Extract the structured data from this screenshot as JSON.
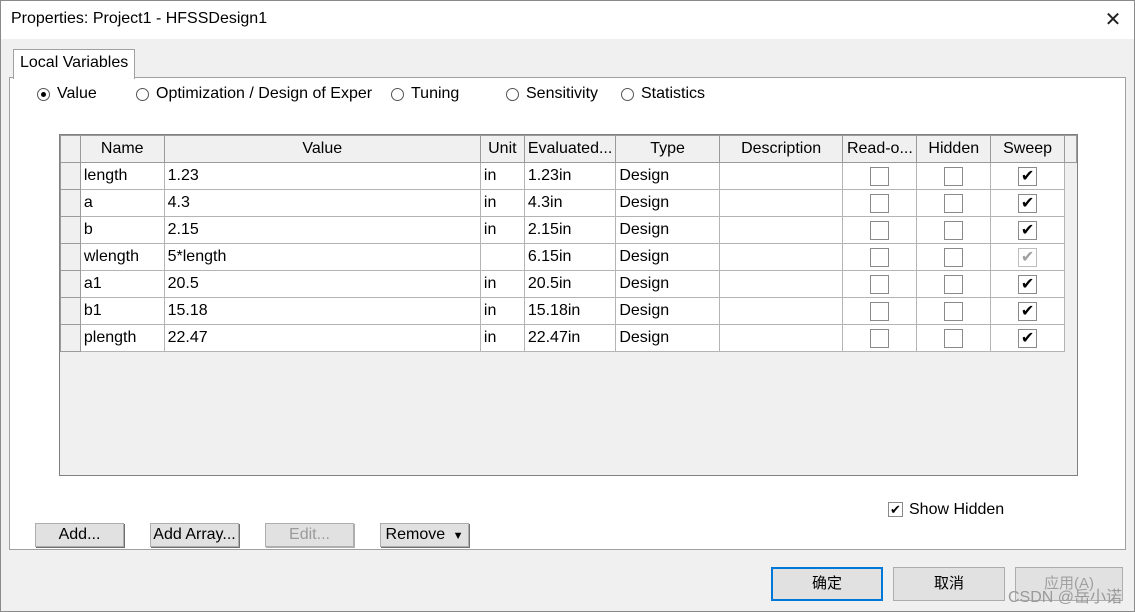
{
  "window": {
    "title": "Properties: Project1 - HFSSDesign1",
    "close_glyph": "✕"
  },
  "tab": {
    "label": "Local Variables"
  },
  "modes": [
    {
      "label": "Value",
      "checked": true
    },
    {
      "label": "Optimization / Design of Exper",
      "checked": false
    },
    {
      "label": "Tuning",
      "checked": false
    },
    {
      "label": "Sensitivity",
      "checked": false
    },
    {
      "label": "Statistics",
      "checked": false
    }
  ],
  "table": {
    "columns": [
      "Name",
      "Value",
      "Unit",
      "Evaluated...",
      "Type",
      "Description",
      "Read-o...",
      "Hidden",
      "Sweep"
    ],
    "rows": [
      {
        "name": "length",
        "value": "1.23",
        "unit": "in",
        "evaluated": "1.23in",
        "type": "Design",
        "description": "",
        "readonly": false,
        "hidden": false,
        "sweep": true,
        "sweep_disabled": false
      },
      {
        "name": "a",
        "value": "4.3",
        "unit": "in",
        "evaluated": "4.3in",
        "type": "Design",
        "description": "",
        "readonly": false,
        "hidden": false,
        "sweep": true,
        "sweep_disabled": false
      },
      {
        "name": "b",
        "value": "2.15",
        "unit": "in",
        "evaluated": "2.15in",
        "type": "Design",
        "description": "",
        "readonly": false,
        "hidden": false,
        "sweep": true,
        "sweep_disabled": false
      },
      {
        "name": "wlength",
        "value": "5*length",
        "unit": "",
        "evaluated": "6.15in",
        "type": "Design",
        "description": "",
        "readonly": false,
        "hidden": false,
        "sweep": true,
        "sweep_disabled": true
      },
      {
        "name": "a1",
        "value": "20.5",
        "unit": "in",
        "evaluated": "20.5in",
        "type": "Design",
        "description": "",
        "readonly": false,
        "hidden": false,
        "sweep": true,
        "sweep_disabled": false
      },
      {
        "name": "b1",
        "value": "15.18",
        "unit": "in",
        "evaluated": "15.18in",
        "type": "Design",
        "description": "",
        "readonly": false,
        "hidden": false,
        "sweep": true,
        "sweep_disabled": false
      },
      {
        "name": "plength",
        "value": "22.47",
        "unit": "in",
        "evaluated": "22.47in",
        "type": "Design",
        "description": "",
        "readonly": false,
        "hidden": false,
        "sweep": true,
        "sweep_disabled": false
      }
    ]
  },
  "show_hidden": {
    "label": "Show Hidden",
    "checked": true
  },
  "buttons": {
    "add": "Add...",
    "add_array": "Add Array...",
    "edit": "Edit...",
    "remove": "Remove",
    "remove_arrow": "▼",
    "ok": "确定",
    "cancel": "取消",
    "apply": "应用(A)"
  },
  "watermark": "CSDN @岳小诺",
  "check_glyph": "✔"
}
